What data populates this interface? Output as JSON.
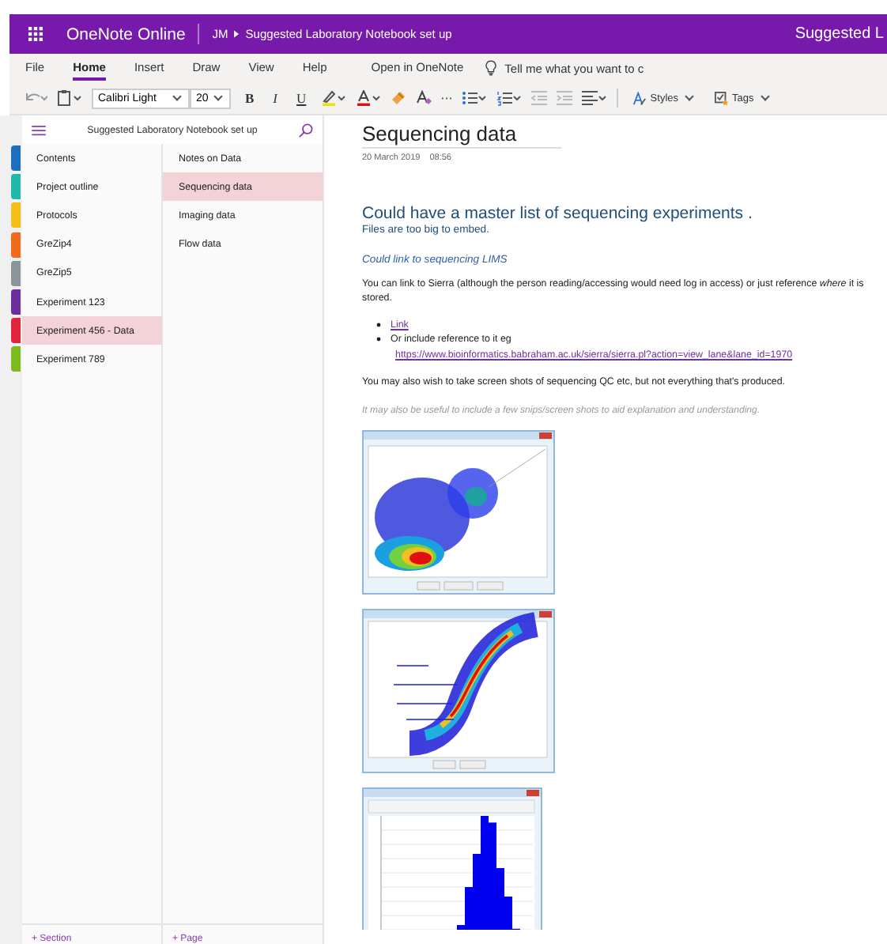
{
  "header": {
    "app_name": "OneNote Online",
    "user": "JM",
    "notebook": "Suggested Laboratory Notebook set up",
    "right_title": "Suggested L"
  },
  "ribbon": {
    "tabs": [
      {
        "label": "File",
        "selected": false
      },
      {
        "label": "Home",
        "selected": true
      },
      {
        "label": "Insert",
        "selected": false
      },
      {
        "label": "Draw",
        "selected": false
      },
      {
        "label": "View",
        "selected": false
      },
      {
        "label": "Help",
        "selected": false
      }
    ],
    "open_in": "Open in OneNote",
    "tell_me": "Tell me what you want to c"
  },
  "toolbar": {
    "font": "Calibri Light",
    "size": "20",
    "bold": "B",
    "italic": "I",
    "underline": "U",
    "more": "···",
    "styles": "Styles",
    "tags": "Tags"
  },
  "notebook": {
    "title": "Suggested Laboratory Notebook set up",
    "sections": [
      {
        "label": "Contents",
        "color": "#1e6fc0",
        "selected": false
      },
      {
        "label": "Project outline",
        "color": "#20b8a8",
        "selected": false
      },
      {
        "label": "Protocols",
        "color": "#f6be16",
        "selected": false
      },
      {
        "label": "GreZip4",
        "color": "#ef6a1a",
        "selected": false
      },
      {
        "label": "GreZip5",
        "color": "#8a9499",
        "selected": false
      },
      {
        "label": "Experiment 123",
        "color": "#6b2fa0",
        "selected": false
      },
      {
        "label": "Experiment 456 - Data",
        "color": "#e2243c",
        "selected": true
      },
      {
        "label": "Experiment 789",
        "color": "#7cbb1e",
        "selected": false
      }
    ],
    "pages": [
      {
        "label": "Notes on Data",
        "selected": false
      },
      {
        "label": "Sequencing data",
        "selected": true
      },
      {
        "label": "Imaging data",
        "selected": false
      },
      {
        "label": "Flow data",
        "selected": false
      }
    ],
    "add_section": "+ Section",
    "add_page": "+ Page"
  },
  "page": {
    "title": "Sequencing data",
    "date": "20 March 2019",
    "time": "08:56",
    "blocks": [
      {
        "kind": "heading",
        "text": "Could have a master list of sequencing experiments ."
      },
      {
        "kind": "text",
        "text": "Files are too big to embed."
      },
      {
        "kind": "subheading",
        "text": "Could link to sequencing LIMS"
      },
      {
        "kind": "text",
        "text": "You can link to Sierra (although the person reading/accessing would need log in access) or just reference *where* it is stored."
      },
      {
        "kind": "bullets",
        "items": [
          {
            "kind": "link",
            "text": "Link"
          },
          {
            "kind": "text",
            "text": "Or include reference to it eg",
            "url": "https://www.bioinformatics.babraham.ac.uk/sierra/sierra.pl?action=view_lane&lane_id=1970"
          }
        ]
      },
      {
        "kind": "text",
        "text": "You may also wish to take screen shots of sequencing QC etc, but not everything that's produced."
      },
      {
        "kind": "note",
        "text": "It may also be useful to include a few snips/screen shots to aid explanation and understanding."
      },
      {
        "kind": "scatter_screenshot"
      },
      {
        "kind": "curve_screenshot"
      },
      {
        "kind": "histogram_screenshot"
      }
    ]
  }
}
